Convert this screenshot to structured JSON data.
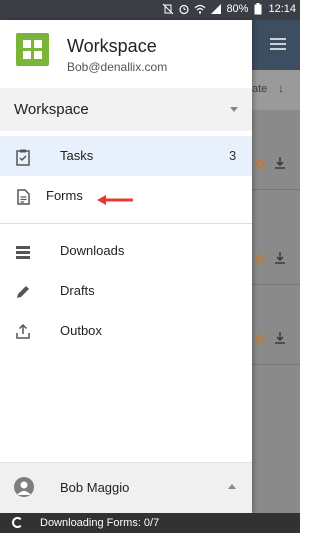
{
  "status_bar": {
    "battery": "80%",
    "time": "12:14",
    "icons": [
      "vibrate-mute-icon",
      "alarm-icon",
      "wifi-icon",
      "signal-icon",
      "battery-icon"
    ]
  },
  "drawer": {
    "header": {
      "title": "Workspace",
      "email": "Bob@denallix.com",
      "logo_color": "#7ab53a"
    },
    "workspace_selector": {
      "label": "Workspace"
    },
    "nav_primary": [
      {
        "label": "Tasks",
        "count": "3",
        "icon": "clipboard-check-icon",
        "active": true
      },
      {
        "label": "Forms",
        "icon": "form-document-icon",
        "active": false
      }
    ],
    "nav_secondary": [
      {
        "label": "Downloads",
        "icon": "list-icon"
      },
      {
        "label": "Drafts",
        "icon": "pencil-icon"
      },
      {
        "label": "Outbox",
        "icon": "upload-icon"
      }
    ],
    "user": {
      "name": "Bob Maggio",
      "icon": "person-avatar-icon"
    }
  },
  "background_app": {
    "sort_label": "ate",
    "sort_arrow": "↓",
    "toolbar_color": "#3d4e60"
  },
  "snackbar": {
    "text": "Downloading Forms: 0/7"
  },
  "colors": {
    "accent_active_bg": "#e8f1fb",
    "annotation_arrow": "#e53935",
    "status_bar": "#3b3f45"
  }
}
